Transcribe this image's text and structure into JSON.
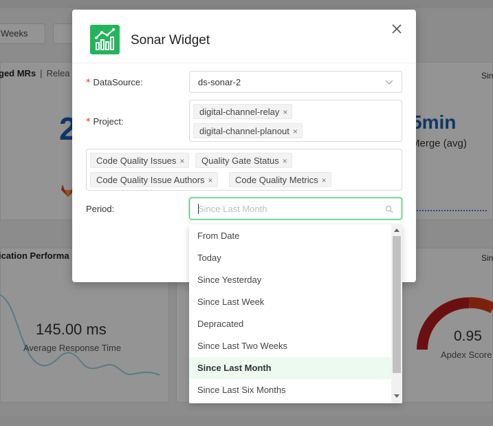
{
  "background": {
    "weeks_button": "Weeks",
    "card1_title": "ged MRs",
    "card1_separator": "|",
    "card1_tab": "Relea",
    "card1_since": "Sin",
    "big_number": "2",
    "time_value": "5min",
    "time_label": "Merge (avg)",
    "card2_title": "ication Performa",
    "card2_since": "Sin",
    "response_value": "145.00 ms",
    "response_label": "Average Response Time",
    "apdex_value": "0.95",
    "apdex_label": "Apdex Score"
  },
  "modal": {
    "title": "Sonar Widget",
    "datasource_label": "DataSource:",
    "datasource_value": "ds-sonar-2",
    "project_label": "Project:",
    "project_tags": [
      "digital-channel-relay",
      "digital-channel-planout"
    ],
    "metric_tags": [
      "Code Quality Issues",
      "Quality Gate Status",
      "Code Quality Issue Authors",
      "Code Quality Metrics"
    ],
    "period_label": "Period:",
    "period_placeholder": "Since Last Month",
    "tag_remove": "×",
    "required_mark": "*"
  },
  "dropdown": {
    "options": [
      "From Date",
      "Today",
      "Since Yesterday",
      "Since Last Week",
      "Depracated",
      "Since Last Two Weeks",
      "Since Last Month",
      "Since Last Six Months"
    ],
    "selected_index": 6
  },
  "colors": {
    "brand_green": "#23b55b",
    "link_blue": "#1a5fb4",
    "required_red": "#f5222d",
    "selected_bg": "#ecfaf0"
  }
}
